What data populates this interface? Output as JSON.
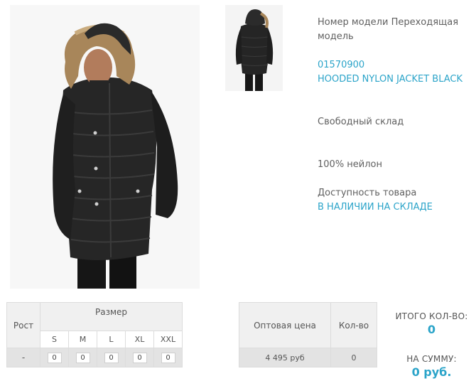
{
  "product": {
    "model_label": "Номер модели",
    "model_value": "Переходящая модель",
    "sku": "01570900",
    "name": "HOODED NYLON JACKET BLACK",
    "warehouse": "Свободный склад",
    "material": "100% нейлон",
    "availability_label": "Доступность товара",
    "availability_value": "В НАЛИЧИИ НА СКЛАДЕ"
  },
  "images": {
    "main": "jacket-front-photo",
    "thumbnail": "jacket-back-photo"
  },
  "size_table": {
    "height_header": "Рост",
    "size_header": "Размер",
    "sizes": [
      "S",
      "M",
      "L",
      "XL",
      "XXL"
    ],
    "height_value": "-",
    "quantities": [
      "0",
      "0",
      "0",
      "0",
      "0"
    ]
  },
  "price_table": {
    "price_header": "Оптовая цена",
    "qty_header": "Кол-во",
    "price_value": "4 495 руб",
    "qty_value": "0"
  },
  "totals": {
    "total_qty_label": "ИТОГО КОЛ-ВО:",
    "total_qty_value": "0",
    "total_sum_label": "НА СУММУ:",
    "total_sum_value": "0 руб."
  },
  "colors": {
    "accent": "#2ba4c9",
    "text": "#555555",
    "table_border": "#dcdcdc",
    "table_header_bg": "#f0f0f0",
    "table_row_bg": "#e3e3e3"
  }
}
